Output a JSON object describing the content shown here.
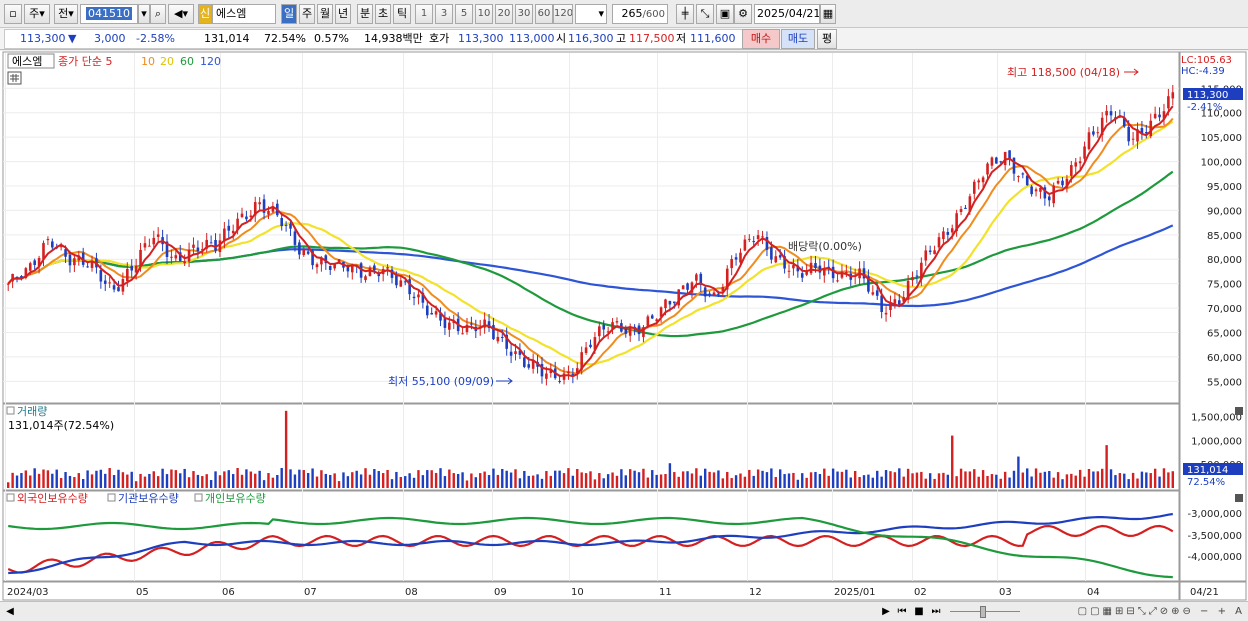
{
  "toolbar": {
    "market": "주",
    "prev": "전",
    "code": "041510",
    "flag": "신",
    "name": "에스엠",
    "periods": [
      "일",
      "주",
      "월",
      "년",
      "분",
      "초",
      "틱"
    ],
    "minutes": [
      "1",
      "3",
      "5",
      "10",
      "20",
      "30",
      "60",
      "120"
    ],
    "count": "265",
    "count_max": "/600",
    "date": "2025/04/21"
  },
  "quote": {
    "price": "113,300",
    "arrow": "▼",
    "change": "3,000",
    "pct": "-2.58%",
    "volume": "131,014",
    "vol_ratio": "72.54%",
    "turnover": "0.57%",
    "amount": "14,938백만",
    "ask_label": "호가",
    "bid": "113,300",
    "ask": "113,000",
    "open_label": "시",
    "open": "116,300",
    "high_label": "고",
    "high": "117,500",
    "low_label": "저",
    "low": "111,600",
    "buy": "매수",
    "sell": "매도",
    "avg": "평"
  },
  "legend": {
    "stock": "에스엠",
    "close_label": "종가 단순",
    "ma5": "5",
    "ma10": "10",
    "ma20": "20",
    "ma60": "60",
    "ma120": "120"
  },
  "annotations": {
    "high": "최고 118,500 (04/18)",
    "low": "최저 55,100 (09/09)",
    "dividend": "배당락(0.00%)",
    "lc": "LC:105.63",
    "hc": "HC:-4.39",
    "current": "113,300",
    "current_pct": "-2.41%",
    "vol_current": "131,014",
    "vol_pct": "72.54%"
  },
  "volume_panel": {
    "title": "거래량",
    "value": "131,014주(72.54%)"
  },
  "holding_panel": {
    "s1": "외국인보유수량",
    "s2": "기관보유수량",
    "s3": "개인보유수량"
  },
  "colors": {
    "up": "#d42020",
    "down": "#1d3fbf",
    "ma5": "#d42020",
    "ma10": "#f08c1e",
    "ma20": "#f2e22a",
    "ma60": "#1e9a3c",
    "ma120": "#2d55d6"
  },
  "chart_data": [
    {
      "type": "candlestick",
      "title": "에스엠",
      "x_ticks": [
        "2024/03",
        "05",
        "06",
        "07",
        "08",
        "09",
        "10",
        "11",
        "12",
        "2025/01",
        "02",
        "03",
        "04",
        "04/21"
      ],
      "y_ticks": [
        55000,
        60000,
        65000,
        70000,
        75000,
        80000,
        85000,
        90000,
        95000,
        100000,
        105000,
        110000,
        115000
      ],
      "ylim": [
        52000,
        121000
      ],
      "high": 118500,
      "low": 55100,
      "last": 113300,
      "close_path": [
        75000,
        77000,
        85000,
        80000,
        78000,
        74000,
        79000,
        84000,
        80000,
        83000,
        82000,
        88000,
        92000,
        88000,
        82000,
        80000,
        78000,
        77000,
        79000,
        74000,
        70000,
        68000,
        65000,
        66000,
        63000,
        58000,
        55500,
        57000,
        63000,
        66000,
        66000,
        68000,
        71000,
        77000,
        72000,
        80000,
        86000,
        80000,
        76000,
        79000,
        77000,
        76000,
        70000,
        73000,
        79000,
        85000,
        92000,
        98000,
        101000,
        96000,
        92000,
        97000,
        106000,
        110000,
        104000,
        109000,
        113300
      ]
    },
    {
      "type": "bar",
      "title": "거래량",
      "y_ticks": [
        "500,000",
        "1,000,000",
        "1,500,000"
      ],
      "ylim": [
        0,
        1700000
      ],
      "last": 131014
    },
    {
      "type": "line",
      "series": [
        {
          "name": "외국인보유수량"
        },
        {
          "name": "기관보유수량"
        },
        {
          "name": "개인보유수량"
        }
      ],
      "y_ticks": [
        "-3,000,000",
        "-3,500,000",
        "-4,000,000"
      ]
    }
  ]
}
